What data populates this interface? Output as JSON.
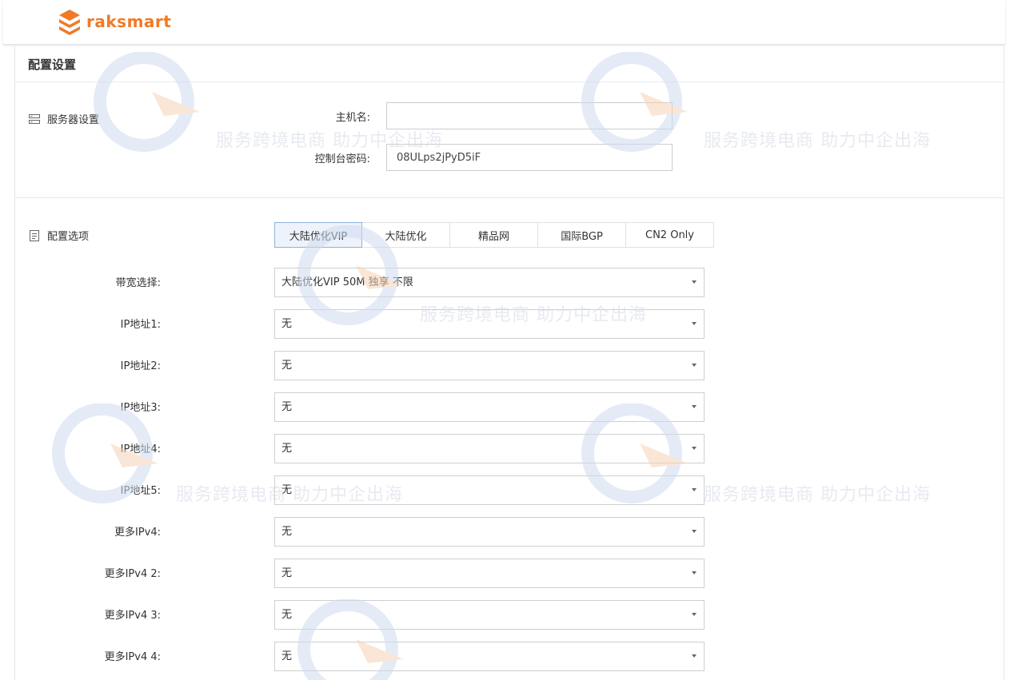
{
  "brand": {
    "name": "raksmart",
    "color": "#f07a26"
  },
  "card": {
    "title": "配置设置"
  },
  "server_settings": {
    "section_label": "服务器设置",
    "hostname": {
      "label": "主机名:",
      "value": ""
    },
    "console_password": {
      "label": "控制台密码:",
      "value": "08ULps2jPyD5iF"
    }
  },
  "config_options": {
    "section_label": "配置选项",
    "tabs": [
      {
        "label": "大陆优化VIP",
        "active": true
      },
      {
        "label": "大陆优化",
        "active": false
      },
      {
        "label": "精品网",
        "active": false
      },
      {
        "label": "国际BGP",
        "active": false
      },
      {
        "label": "CN2 Only",
        "active": false
      }
    ],
    "rows": [
      {
        "label": "带宽选择:",
        "value": "大陆优化VIP 50M 独享 不限"
      },
      {
        "label": "IP地址1:",
        "value": "无"
      },
      {
        "label": "IP地址2:",
        "value": "无"
      },
      {
        "label": "IP地址3:",
        "value": "无"
      },
      {
        "label": "IP地址4:",
        "value": "无"
      },
      {
        "label": "IP地址5:",
        "value": "无"
      },
      {
        "label": "更多IPv4:",
        "value": "无"
      },
      {
        "label": "更多IPv4 2:",
        "value": "无"
      },
      {
        "label": "更多IPv4 3:",
        "value": "无"
      },
      {
        "label": "更多IPv4 4:",
        "value": "无"
      }
    ]
  },
  "watermark": {
    "slogan": "服务跨境电商 助力中企出海"
  }
}
